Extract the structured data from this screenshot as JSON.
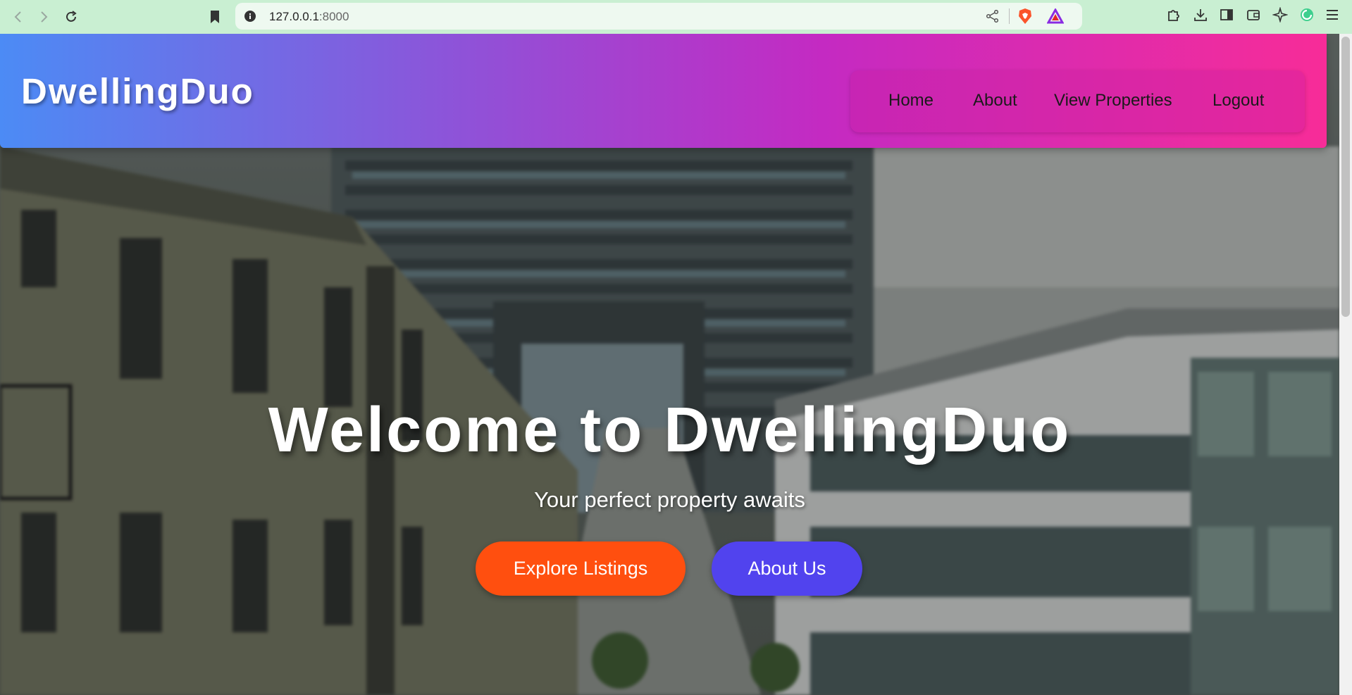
{
  "browser": {
    "url_host": "127.0.0.1",
    "url_port": ":8000",
    "icons": [
      "back-icon",
      "forward-icon",
      "reload-icon",
      "bookmark-icon",
      "site-info-icon",
      "share-icon",
      "brave-shield-icon",
      "brave-rewards-icon",
      "extensions-icon",
      "download-icon",
      "sidebar-icon",
      "wallet-icon",
      "leo-icon",
      "vpn-icon",
      "menu-icon"
    ]
  },
  "site": {
    "brand": "DwellingDuo",
    "nav": {
      "home": "Home",
      "about": "About",
      "view_properties": "View Properties",
      "logout": "Logout"
    },
    "hero": {
      "title": "Welcome to DwellingDuo",
      "subtitle": "Your perfect property awaits",
      "explore_button": "Explore Listings",
      "about_button": "About Us"
    }
  },
  "colors": {
    "header_gradient_start": "#4c8bf5",
    "header_gradient_mid": "#c42ac2",
    "header_gradient_end": "#f72c98",
    "explore_button": "#ff4f0f",
    "about_button": "#5143ee",
    "browser_chrome": "#c9efd2"
  }
}
